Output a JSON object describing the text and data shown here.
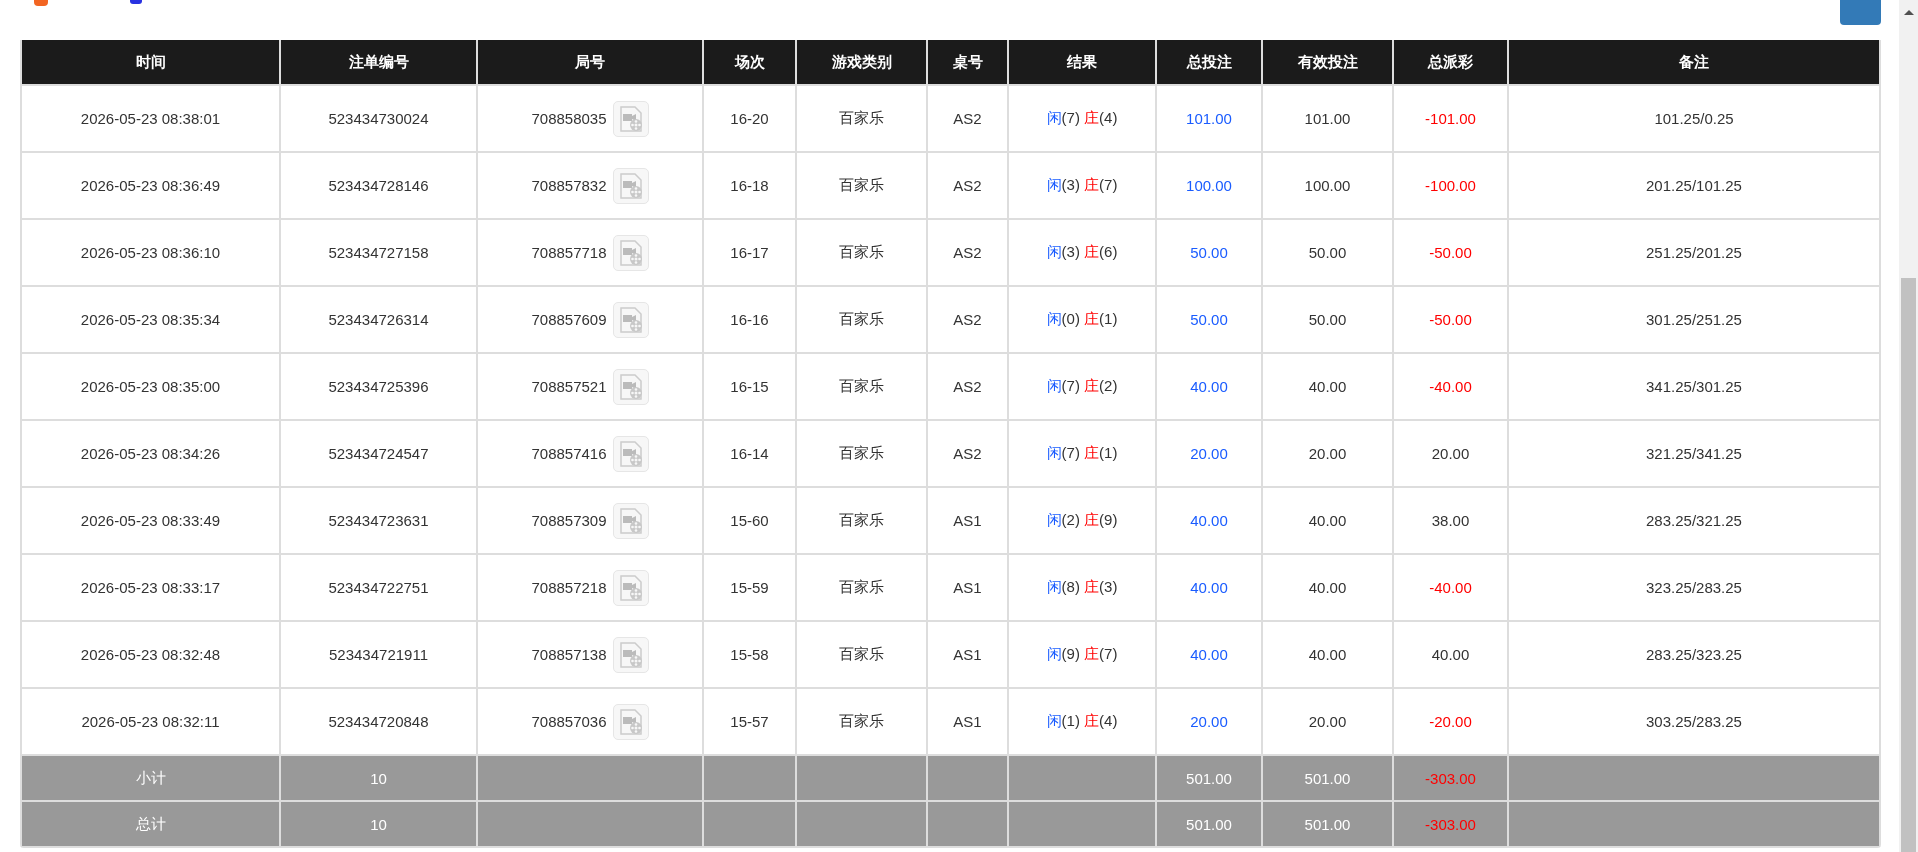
{
  "table": {
    "columns": [
      "时间",
      "注单编号",
      "局号",
      "场次",
      "游戏类别",
      "桌号",
      "结果",
      "总投注",
      "有效投注",
      "总派彩",
      "备注"
    ],
    "rows": [
      {
        "time": "2026-05-23 08:38:01",
        "bet_no": "523434730024",
        "round": "708858035",
        "shoe": "16-20",
        "game": "百家乐",
        "table": "AS2",
        "result": {
          "player_label": "闲",
          "player": "(7)",
          "banker_label": "庄",
          "banker": "(4)"
        },
        "total_bet": "101.00",
        "valid_bet": "101.00",
        "payout": "-101.00",
        "loss": true,
        "note": "101.25/0.25"
      },
      {
        "time": "2026-05-23 08:36:49",
        "bet_no": "523434728146",
        "round": "708857832",
        "shoe": "16-18",
        "game": "百家乐",
        "table": "AS2",
        "result": {
          "player_label": "闲",
          "player": "(3)",
          "banker_label": "庄",
          "banker": "(7)"
        },
        "total_bet": "100.00",
        "valid_bet": "100.00",
        "payout": "-100.00",
        "loss": true,
        "note": "201.25/101.25"
      },
      {
        "time": "2026-05-23 08:36:10",
        "bet_no": "523434727158",
        "round": "708857718",
        "shoe": "16-17",
        "game": "百家乐",
        "table": "AS2",
        "result": {
          "player_label": "闲",
          "player": "(3)",
          "banker_label": "庄",
          "banker": "(6)"
        },
        "total_bet": "50.00",
        "valid_bet": "50.00",
        "payout": "-50.00",
        "loss": true,
        "note": "251.25/201.25"
      },
      {
        "time": "2026-05-23 08:35:34",
        "bet_no": "523434726314",
        "round": "708857609",
        "shoe": "16-16",
        "game": "百家乐",
        "table": "AS2",
        "result": {
          "player_label": "闲",
          "player": "(0)",
          "banker_label": "庄",
          "banker": "(1)"
        },
        "total_bet": "50.00",
        "valid_bet": "50.00",
        "payout": "-50.00",
        "loss": true,
        "note": "301.25/251.25"
      },
      {
        "time": "2026-05-23 08:35:00",
        "bet_no": "523434725396",
        "round": "708857521",
        "shoe": "16-15",
        "game": "百家乐",
        "table": "AS2",
        "result": {
          "player_label": "闲",
          "player": "(7)",
          "banker_label": "庄",
          "banker": "(2)"
        },
        "total_bet": "40.00",
        "valid_bet": "40.00",
        "payout": "-40.00",
        "loss": true,
        "note": "341.25/301.25"
      },
      {
        "time": "2026-05-23 08:34:26",
        "bet_no": "523434724547",
        "round": "708857416",
        "shoe": "16-14",
        "game": "百家乐",
        "table": "AS2",
        "result": {
          "player_label": "闲",
          "player": "(7)",
          "banker_label": "庄",
          "banker": "(1)"
        },
        "total_bet": "20.00",
        "valid_bet": "20.00",
        "payout": "20.00",
        "loss": false,
        "note": "321.25/341.25"
      },
      {
        "time": "2026-05-23 08:33:49",
        "bet_no": "523434723631",
        "round": "708857309",
        "shoe": "15-60",
        "game": "百家乐",
        "table": "AS1",
        "result": {
          "player_label": "闲",
          "player": "(2)",
          "banker_label": "庄",
          "banker": "(9)"
        },
        "total_bet": "40.00",
        "valid_bet": "40.00",
        "payout": "38.00",
        "loss": false,
        "note": "283.25/321.25"
      },
      {
        "time": "2026-05-23 08:33:17",
        "bet_no": "523434722751",
        "round": "708857218",
        "shoe": "15-59",
        "game": "百家乐",
        "table": "AS1",
        "result": {
          "player_label": "闲",
          "player": "(8)",
          "banker_label": "庄",
          "banker": "(3)"
        },
        "total_bet": "40.00",
        "valid_bet": "40.00",
        "payout": "-40.00",
        "loss": true,
        "note": "323.25/283.25"
      },
      {
        "time": "2026-05-23 08:32:48",
        "bet_no": "523434721911",
        "round": "708857138",
        "shoe": "15-58",
        "game": "百家乐",
        "table": "AS1",
        "result": {
          "player_label": "闲",
          "player": "(9)",
          "banker_label": "庄",
          "banker": "(7)"
        },
        "total_bet": "40.00",
        "valid_bet": "40.00",
        "payout": "40.00",
        "loss": false,
        "note": "283.25/323.25"
      },
      {
        "time": "2026-05-23 08:32:11",
        "bet_no": "523434720848",
        "round": "708857036",
        "shoe": "15-57",
        "game": "百家乐",
        "table": "AS1",
        "result": {
          "player_label": "闲",
          "player": "(1)",
          "banker_label": "庄",
          "banker": "(4)"
        },
        "total_bet": "20.00",
        "valid_bet": "20.00",
        "payout": "-20.00",
        "loss": true,
        "note": "303.25/283.25"
      }
    ],
    "summary_rows": [
      {
        "label": "小计",
        "count": "10",
        "total_bet": "501.00",
        "valid_bet": "501.00",
        "payout": "-303.00",
        "loss": true
      },
      {
        "label": "总计",
        "count": "10",
        "total_bet": "501.00",
        "valid_bet": "501.00",
        "payout": "-303.00",
        "loss": true
      }
    ]
  }
}
